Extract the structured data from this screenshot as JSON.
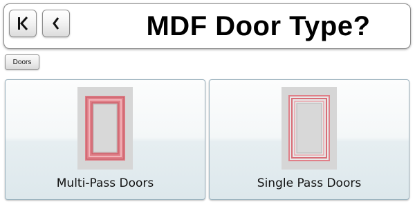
{
  "header": {
    "title": "MDF Door Type?",
    "nav": {
      "first_icon": "skip-to-first-icon",
      "back_icon": "chevron-left-icon"
    }
  },
  "breadcrumb": {
    "items": [
      "Doors"
    ]
  },
  "options": [
    {
      "label": "Multi-Pass Doors",
      "image": "multi-pass-door-frame"
    },
    {
      "label": "Single Pass Doors",
      "image": "single-pass-door-frame"
    }
  ],
  "colors": {
    "door_frame": "#e07f88",
    "door_panel": "#d6d6d6",
    "card_border": "#9cb3bf"
  }
}
